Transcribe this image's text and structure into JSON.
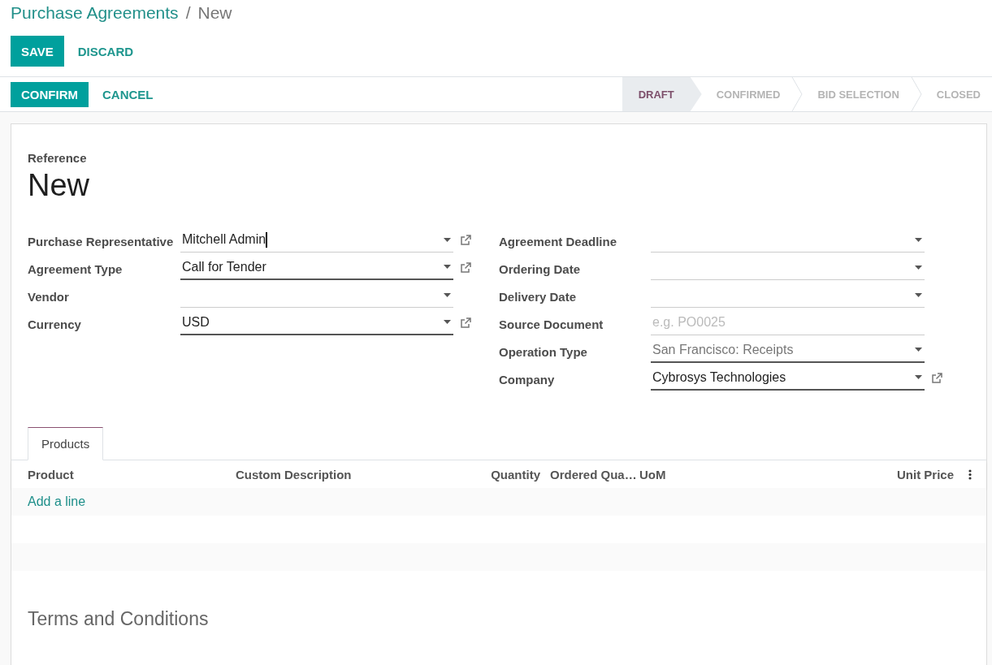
{
  "breadcrumb": {
    "parent": "Purchase Agreements",
    "separator": "/",
    "current": "New"
  },
  "edit_buttons": [
    {
      "label": "SAVE",
      "kind": "primary"
    },
    {
      "label": "DISCARD",
      "kind": "link"
    }
  ],
  "action_buttons": [
    {
      "label": "CONFIRM",
      "kind": "primary"
    },
    {
      "label": "CANCEL",
      "kind": "link"
    }
  ],
  "statuses": [
    {
      "label": "DRAFT",
      "selected": true
    },
    {
      "label": "CONFIRMED",
      "selected": false
    },
    {
      "label": "BID SELECTION",
      "selected": false
    },
    {
      "label": "CLOSED",
      "selected": false
    }
  ],
  "reference": {
    "label": "Reference",
    "value": "New"
  },
  "left_fields": [
    {
      "label": "Purchase Representative",
      "value": "Mitchell Admin",
      "kind": "select",
      "required": false,
      "focused": true,
      "external_link": true
    },
    {
      "label": "Agreement Type",
      "value": "Call for Tender",
      "kind": "select",
      "required": true,
      "focused": false,
      "external_link": true
    },
    {
      "label": "Vendor",
      "kind": "select",
      "required": false,
      "focused": false,
      "external_link": false
    },
    {
      "label": "Currency",
      "value": "USD",
      "kind": "select",
      "required": true,
      "focused": false,
      "external_link": true
    }
  ],
  "right_fields": [
    {
      "label": "Agreement Deadline",
      "kind": "date",
      "required": false,
      "focused": false,
      "external_link": false
    },
    {
      "label": "Ordering Date",
      "kind": "date",
      "required": false,
      "focused": false,
      "external_link": false
    },
    {
      "label": "Delivery Date",
      "kind": "date",
      "required": false,
      "focused": false,
      "external_link": false
    },
    {
      "label": "Source Document",
      "placeholder": "e.g. PO0025",
      "kind": "text",
      "required": false,
      "focused": false,
      "external_link": false
    },
    {
      "label": "Operation Type",
      "value": "San Francisco: Receipts",
      "kind": "select",
      "required": true,
      "focused": false,
      "external_link": false
    },
    {
      "label": "Company",
      "value": "Cybrosys Technologies",
      "kind": "select",
      "required": true,
      "focused": false,
      "external_link": true
    }
  ],
  "notebook_tabs": [
    {
      "label": "Products",
      "selected": true
    }
  ],
  "table": {
    "columns": [
      {
        "label": "Product"
      },
      {
        "label": "Custom Description"
      },
      {
        "label": "Quantity"
      },
      {
        "label": "Ordered Qua…"
      },
      {
        "label": "UoM"
      },
      {
        "label": "Unit Price"
      }
    ],
    "add_line": "Add a line"
  },
  "terms_heading": "Terms and Conditions"
}
